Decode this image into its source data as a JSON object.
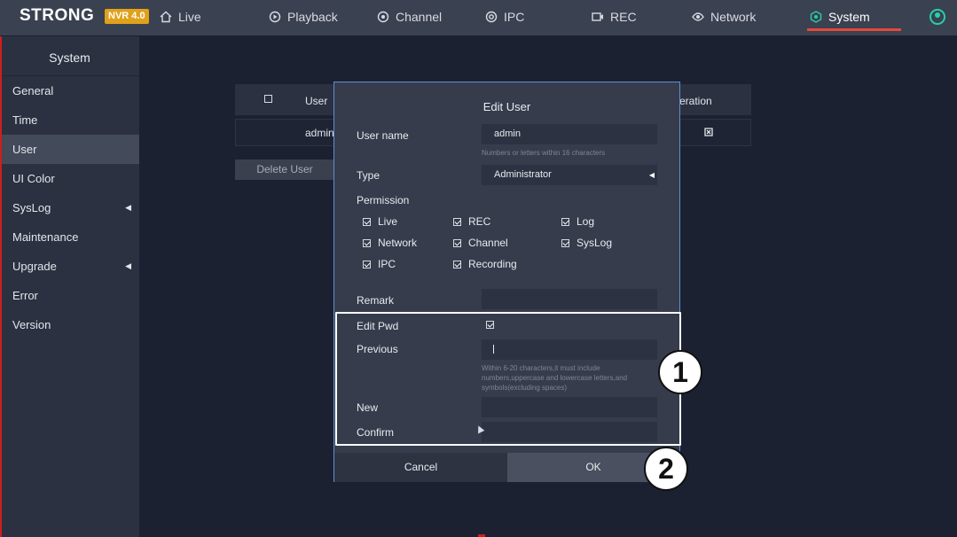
{
  "brand": {
    "name": "STRONG",
    "badge": "NVR 4.0"
  },
  "nav": {
    "items": [
      {
        "label": "Live",
        "icon": "home-icon"
      },
      {
        "label": "Playback",
        "icon": "playback-icon"
      },
      {
        "label": "Channel",
        "icon": "channel-icon"
      },
      {
        "label": "IPC",
        "icon": "ipc-icon"
      },
      {
        "label": "REC",
        "icon": "rec-icon"
      },
      {
        "label": "Network",
        "icon": "network-icon"
      },
      {
        "label": "System",
        "icon": "system-icon"
      }
    ],
    "active": "System",
    "active_color": "#e24a3a"
  },
  "sidebar": {
    "title": "System",
    "items": [
      {
        "label": "General"
      },
      {
        "label": "Time"
      },
      {
        "label": "User"
      },
      {
        "label": "UI  Color"
      },
      {
        "label": "SysLog"
      },
      {
        "label": "Maintenance"
      },
      {
        "label": "Upgrade"
      },
      {
        "label": "Error"
      },
      {
        "label": "Version"
      }
    ],
    "active": "User"
  },
  "user_table": {
    "header_user": "User",
    "header_operation": "eration",
    "row_user": "admin",
    "delete_button": "Delete  User"
  },
  "dialog": {
    "title": "Edit  User",
    "user_name_label": "User  name",
    "user_name_value": "admin",
    "user_name_hint": "Numbers  or  letters  within  16  characters",
    "type_label": "Type",
    "type_value": "Administrator",
    "permission_label": "Permission",
    "permissions": [
      {
        "label": "Live",
        "checked": true
      },
      {
        "label": "REC",
        "checked": true
      },
      {
        "label": "Log",
        "checked": true
      },
      {
        "label": "Network",
        "checked": true
      },
      {
        "label": "Channel",
        "checked": true
      },
      {
        "label": "SysLog",
        "checked": true
      },
      {
        "label": "IPC",
        "checked": true
      },
      {
        "label": "Recording",
        "checked": true
      }
    ],
    "remark_label": "Remark",
    "remark_value": "",
    "edit_pwd_label": "Edit  Pwd",
    "edit_pwd_checked": true,
    "previous_label": "Previous",
    "previous_value": "",
    "password_hint_1": "Within  6-20  characters,it  must  include",
    "password_hint_2": "numbers,uppercase  and  lowercase  letters,and",
    "password_hint_3": "symbols(excluding  spaces)",
    "new_label": "New",
    "confirm_label": "Confirm",
    "cancel_label": "Cancel",
    "ok_label": "OK"
  },
  "annotations": {
    "step1": "1",
    "step2": "2"
  },
  "colors": {
    "accent": "#e24a3a",
    "badge": "#e0a11b",
    "dialog_border": "#5d8fd1",
    "user_icon": "#27d0a8"
  }
}
